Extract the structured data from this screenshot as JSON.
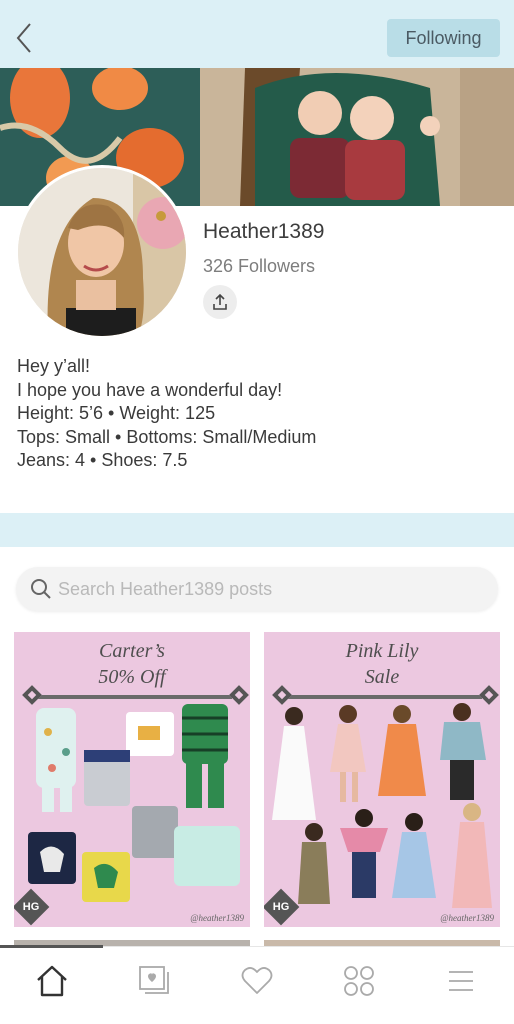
{
  "header": {
    "follow_label": "Following"
  },
  "profile": {
    "username": "Heather1389",
    "followers": "326 Followers"
  },
  "bio": {
    "lines": [
      "Hey y’all!",
      "I hope you have a wonderful day!",
      "Height: 5’6 • Weight: 125",
      "Tops: Small • Bottoms: Small/Medium",
      "Jeans: 4 • Shoes: 7.5"
    ]
  },
  "search": {
    "placeholder": "Search Heather1389 posts"
  },
  "posts": [
    {
      "title_line1": "Carter’s",
      "title_line2": "50% Off",
      "badge": "HG",
      "watermark": "@heather1389"
    },
    {
      "title_line1": "Pink Lily",
      "title_line2": "Sale",
      "badge": "HG",
      "watermark": "@heather1389"
    }
  ],
  "tabs": [
    "home-icon",
    "photos-icon",
    "heart-icon",
    "grid-icon",
    "menu-icon"
  ],
  "colors": {
    "header_bg": "#dcf0f6",
    "following_button": "#b9dde7",
    "card_bg": "#ecc8e0"
  }
}
